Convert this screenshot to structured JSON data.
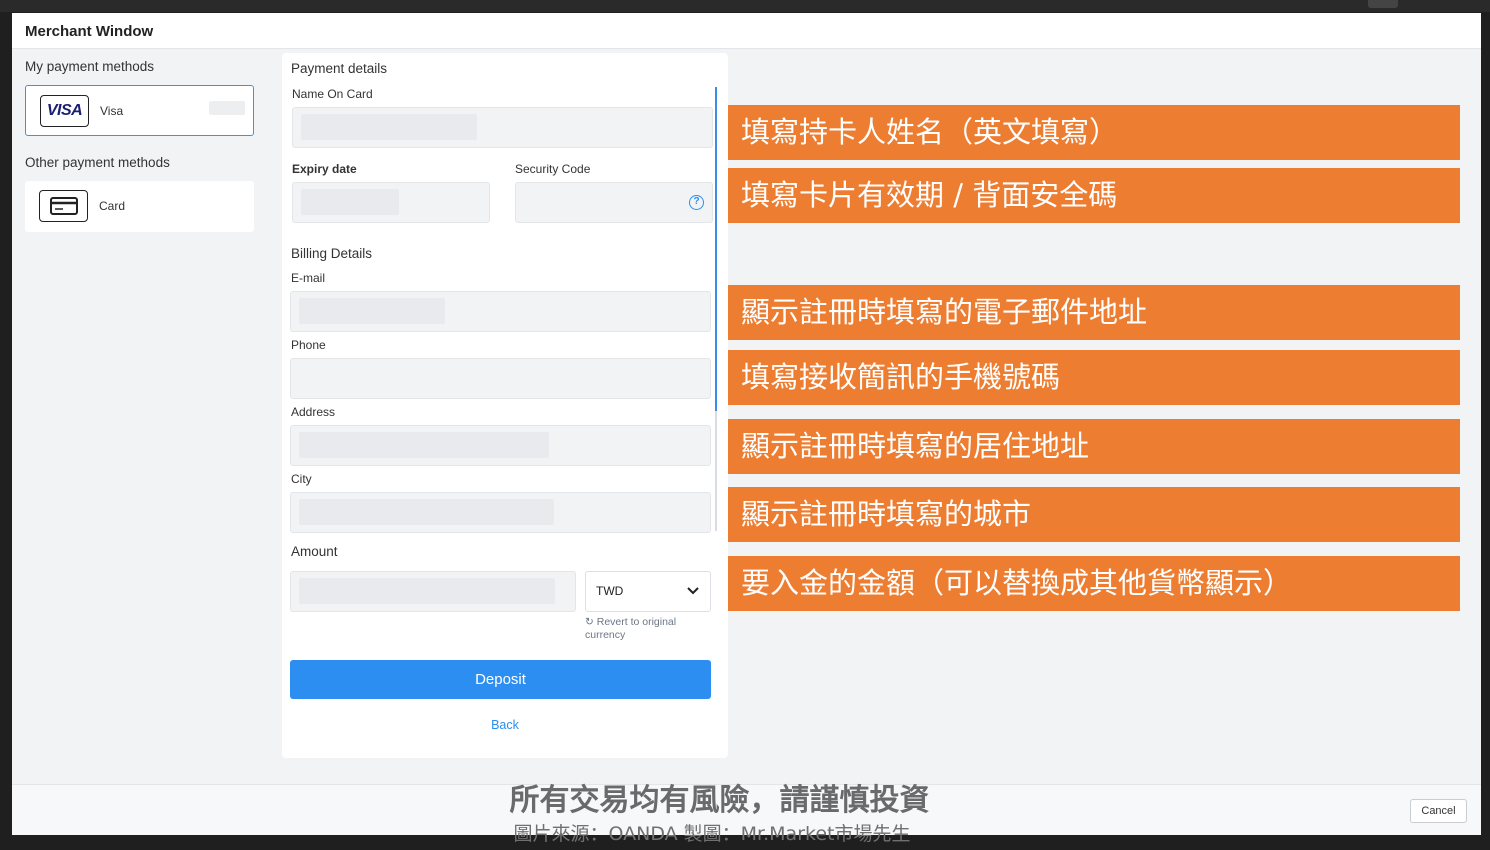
{
  "window": {
    "title": "Merchant Window"
  },
  "left": {
    "my_methods_label": "My payment methods",
    "my_methods": [
      {
        "name": "Visa",
        "logo": "VISA",
        "icon": "visa-logo-icon"
      }
    ],
    "other_methods_label": "Other payment methods",
    "other_methods": [
      {
        "name": "Card",
        "icon": "credit-card-icon"
      }
    ]
  },
  "form": {
    "payment_details_title": "Payment details",
    "name_on_card_label": "Name On Card",
    "expiry_label": "Expiry date",
    "security_label": "Security Code",
    "billing_title": "Billing Details",
    "email_label": "E-mail",
    "phone_label": "Phone",
    "address_label": "Address",
    "city_label": "City",
    "amount_label": "Amount",
    "currency": "TWD",
    "revert_text": "Revert to original currency",
    "deposit_label": "Deposit",
    "back_label": "Back"
  },
  "annotations": [
    "填寫持卡人姓名（英文填寫）",
    "填寫卡片有效期 / 背面安全碼",
    "顯示註冊時填寫的電子郵件地址",
    "填寫接收簡訊的手機號碼",
    "顯示註冊時填寫的居住地址",
    "顯示註冊時填寫的城市",
    "要入金的金額（可以替換成其他貨幣顯示）"
  ],
  "footer": {
    "cancel_label": "Cancel"
  },
  "watermark": {
    "main": "所有交易均有風險，請謹慎投資",
    "sub": "圖片來源：OANDA 製圖：Mr.Market市場先生"
  },
  "colors": {
    "accent": "#2b8ef0",
    "annotation": "#ed7d31",
    "selected_border": "#4a90d9"
  }
}
